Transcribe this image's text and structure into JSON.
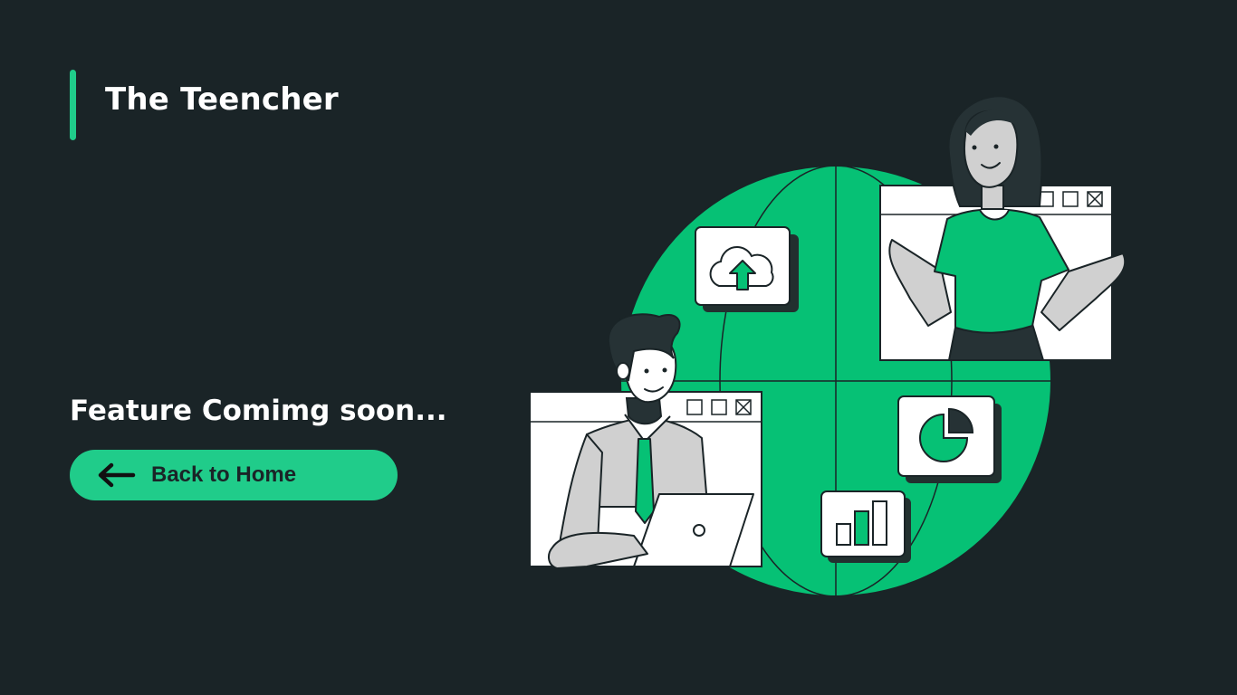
{
  "brand": {
    "title": "The Teencher"
  },
  "main": {
    "headline": "Feature Comimg soon...",
    "back_button": {
      "label": "Back to Home",
      "icon": "arrow-left-icon"
    }
  },
  "colors": {
    "background": "#1a2427",
    "accent": "#20cc8a",
    "illustration_green": "#06c175",
    "text": "#ffffff"
  },
  "illustration": {
    "name": "online-teaching-illustration"
  }
}
